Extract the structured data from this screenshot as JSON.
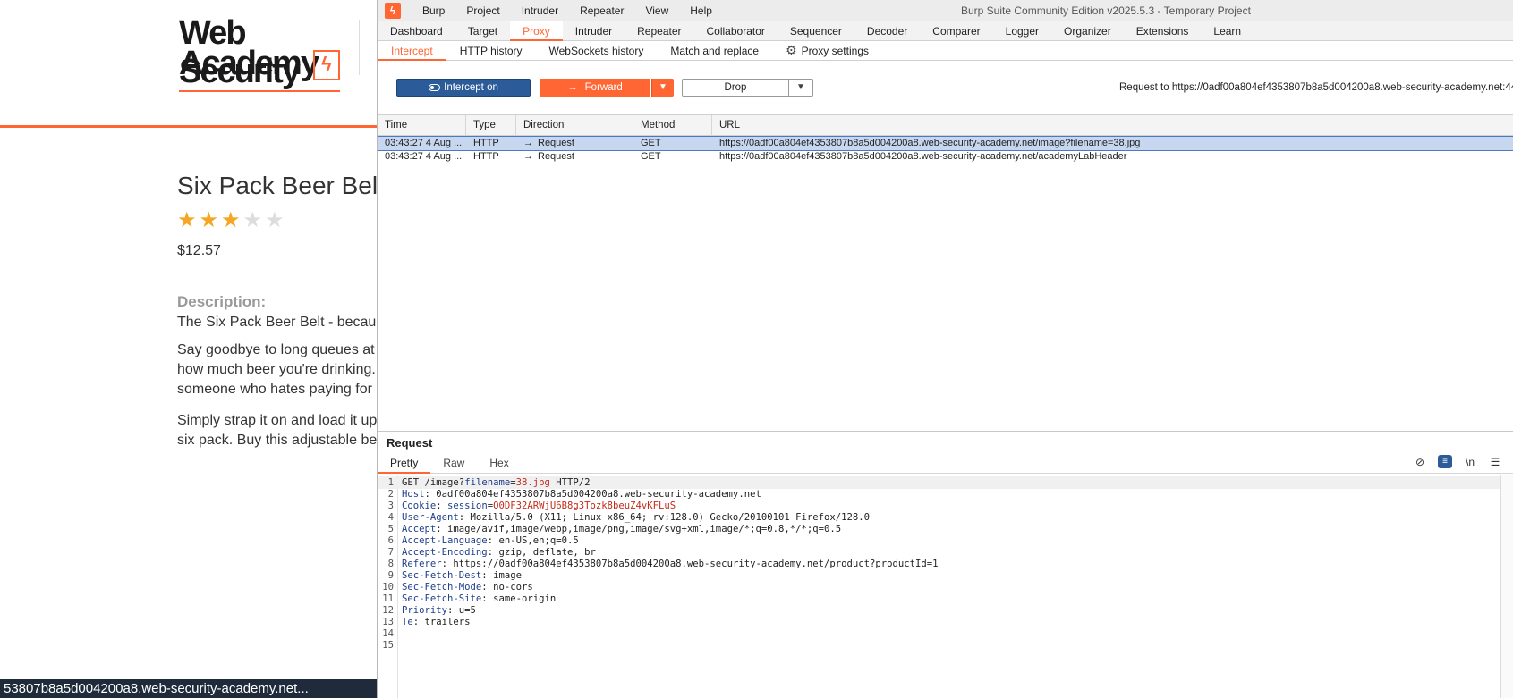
{
  "webpage": {
    "logo_line1": "Web Security",
    "logo_line2": "Academy",
    "logo_mark": "ϟ",
    "product_title": "Six Pack Beer Belt",
    "rating": 3,
    "stars_total": 5,
    "price": "$12.57",
    "description_label": "Description:",
    "description_lines": [
      "The Six Pack Beer Belt - becau",
      "Say goodbye to long queues at",
      "how much beer you're drinking.",
      "someone who hates paying for",
      "Simply strap it on and load it up",
      "six pack. Buy this adjustable be"
    ],
    "status_bar": "53807b8a5d004200a8.web-security-academy.net..."
  },
  "burp": {
    "app_icon": "ϟ",
    "menu": [
      "Burp",
      "Project",
      "Intruder",
      "Repeater",
      "View",
      "Help"
    ],
    "window_title": "Burp Suite Community Edition v2025.5.3 - Temporary Project",
    "main_tabs": [
      "Dashboard",
      "Target",
      "Proxy",
      "Intruder",
      "Repeater",
      "Collaborator",
      "Sequencer",
      "Decoder",
      "Comparer",
      "Logger",
      "Organizer",
      "Extensions",
      "Learn"
    ],
    "active_main_tab": "Proxy",
    "sub_tabs": [
      "Intercept",
      "HTTP history",
      "WebSockets history",
      "Match and replace",
      "Proxy settings"
    ],
    "active_sub_tab": "Intercept",
    "toolbar": {
      "intercept_label": "Intercept on",
      "forward_label": "Forward",
      "drop_label": "Drop",
      "request_to": "Request to https://0adf00a804ef4353807b8a5d004200a8.web-security-academy.net:44"
    },
    "table": {
      "headers": [
        "Time",
        "Type",
        "Direction",
        "Method",
        "URL"
      ],
      "rows": [
        {
          "time": "03:43:27 4 Aug ...",
          "type": "HTTP",
          "direction": "Request",
          "method": "GET",
          "url": "https://0adf00a804ef4353807b8a5d004200a8.web-security-academy.net/image?filename=38.jpg",
          "selected": true
        },
        {
          "time": "03:43:27 4 Aug ...",
          "type": "HTTP",
          "direction": "Request",
          "method": "GET",
          "url": "https://0adf00a804ef4353807b8a5d004200a8.web-security-academy.net/academyLabHeader",
          "selected": false
        }
      ]
    },
    "request_panel": {
      "title": "Request",
      "tabs": [
        "Pretty",
        "Raw",
        "Hex"
      ],
      "active_tab": "Pretty",
      "newline_label": "\\n",
      "request_line": {
        "method": "GET",
        "path": "/image?",
        "param_name": "filename",
        "equals": "=",
        "param_value": "38.jpg",
        "protocol": "HTTP/2"
      },
      "headers": [
        {
          "name": "Host",
          "value": "0adf00a804ef4353807b8a5d004200a8.web-security-academy.net"
        },
        {
          "name": "Cookie",
          "value": "session=O0DF32ARWjU6B8g3Tozk8beuZ4vKFLuS",
          "cookie": true,
          "cookie_name": "session",
          "cookie_value": "O0DF32ARWjU6B8g3Tozk8beuZ4vKFLuS"
        },
        {
          "name": "User-Agent",
          "value": "Mozilla/5.0 (X11; Linux x86_64; rv:128.0) Gecko/20100101 Firefox/128.0"
        },
        {
          "name": "Accept",
          "value": "image/avif,image/webp,image/png,image/svg+xml,image/*;q=0.8,*/*;q=0.5"
        },
        {
          "name": "Accept-Language",
          "value": "en-US,en;q=0.5"
        },
        {
          "name": "Accept-Encoding",
          "value": "gzip, deflate, br"
        },
        {
          "name": "Referer",
          "value": "https://0adf00a804ef4353807b8a5d004200a8.web-security-academy.net/product?productId=1"
        },
        {
          "name": "Sec-Fetch-Dest",
          "value": "image"
        },
        {
          "name": "Sec-Fetch-Mode",
          "value": "no-cors"
        },
        {
          "name": "Sec-Fetch-Site",
          "value": "same-origin"
        },
        {
          "name": "Priority",
          "value": "u=5"
        },
        {
          "name": "Te",
          "value": "trailers"
        }
      ],
      "line_numbers": [
        "1",
        "2",
        "3",
        "4",
        "5",
        "6",
        "7",
        "8",
        "9",
        "10",
        "11",
        "12",
        "13",
        "14",
        "15"
      ]
    },
    "colors": {
      "accent": "#ff6633",
      "intercept_blue": "#2b5c99",
      "selection": "#c7d7f0"
    }
  }
}
